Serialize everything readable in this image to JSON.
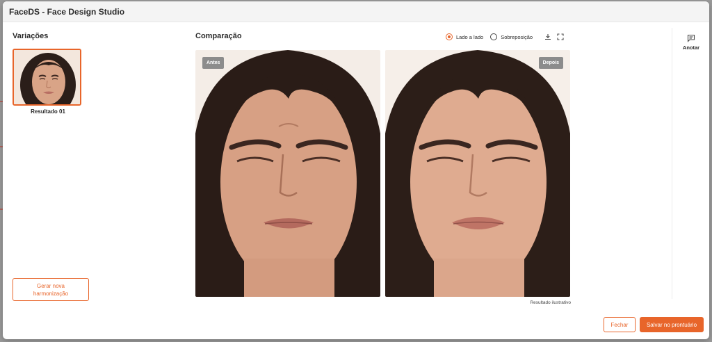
{
  "window": {
    "title": "FaceDS - Face Design Studio"
  },
  "variations": {
    "title": "Variações",
    "items": [
      {
        "label": "Resultado 01",
        "selected": true
      }
    ],
    "generate_button": "Gerar nova harmonização"
  },
  "comparison": {
    "title": "Comparação",
    "modes": [
      {
        "label": "Lado a lado",
        "selected": true
      },
      {
        "label": "Sobreposição",
        "selected": false
      }
    ],
    "tools": [
      "download-icon",
      "fullscreen-icon"
    ],
    "before_badge": "Antes",
    "after_badge": "Depois",
    "caption": "Resultado ilustrativo"
  },
  "sidebar": {
    "annotate_label": "Anotar",
    "annotate_icon": "comment-icon"
  },
  "footer": {
    "close_label": "Fechar",
    "save_label": "Salvar no prontuário"
  },
  "colors": {
    "accent": "#e8652a",
    "badge": "#8c8c8c",
    "header_bg": "#f4f4f4"
  }
}
